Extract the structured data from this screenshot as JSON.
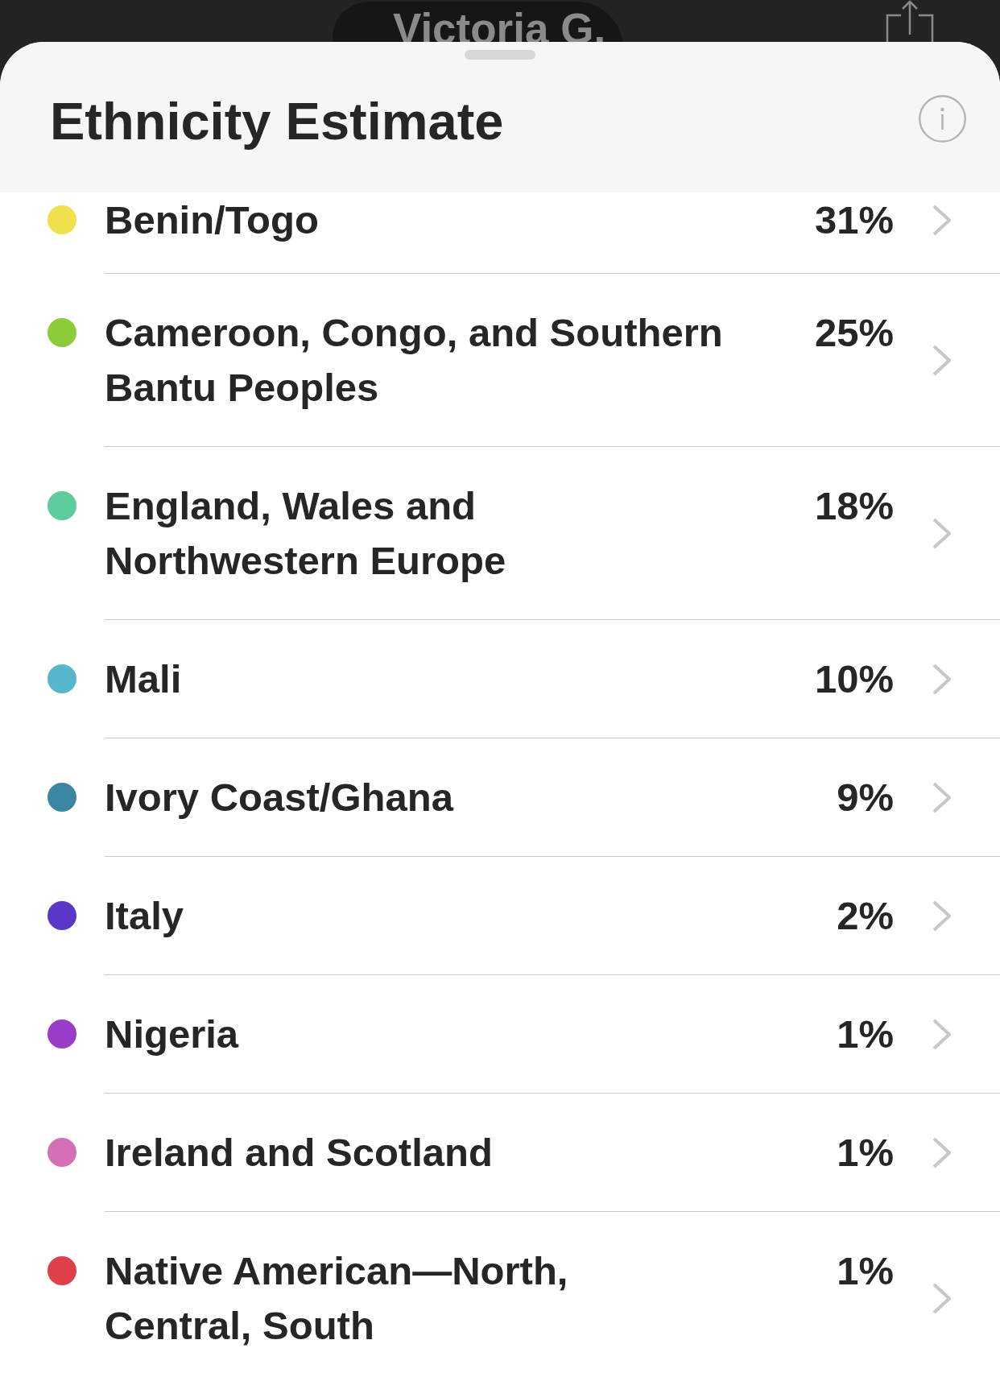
{
  "profile": {
    "name": "Victoria G."
  },
  "sheet": {
    "title": "Ethnicity Estimate"
  },
  "ethnicities": [
    {
      "name": "Benin/Togo",
      "percent": "31%",
      "color": "#efe04c"
    },
    {
      "name": "Cameroon, Congo, and Southern Bantu Peoples",
      "percent": "25%",
      "color": "#8dcb3b"
    },
    {
      "name": "England, Wales and Northwestern Europe",
      "percent": "18%",
      "color": "#5ccc9a"
    },
    {
      "name": "Mali",
      "percent": "10%",
      "color": "#56b6cc"
    },
    {
      "name": "Ivory Coast/Ghana",
      "percent": "9%",
      "color": "#3b87a3"
    },
    {
      "name": "Italy",
      "percent": "2%",
      "color": "#5b36c9"
    },
    {
      "name": "Nigeria",
      "percent": "1%",
      "color": "#9a3cc8"
    },
    {
      "name": "Ireland and Scotland",
      "percent": "1%",
      "color": "#d46fb6"
    },
    {
      "name": "Native American—North, Central, South",
      "percent": "1%",
      "color": "#de3f48"
    }
  ]
}
